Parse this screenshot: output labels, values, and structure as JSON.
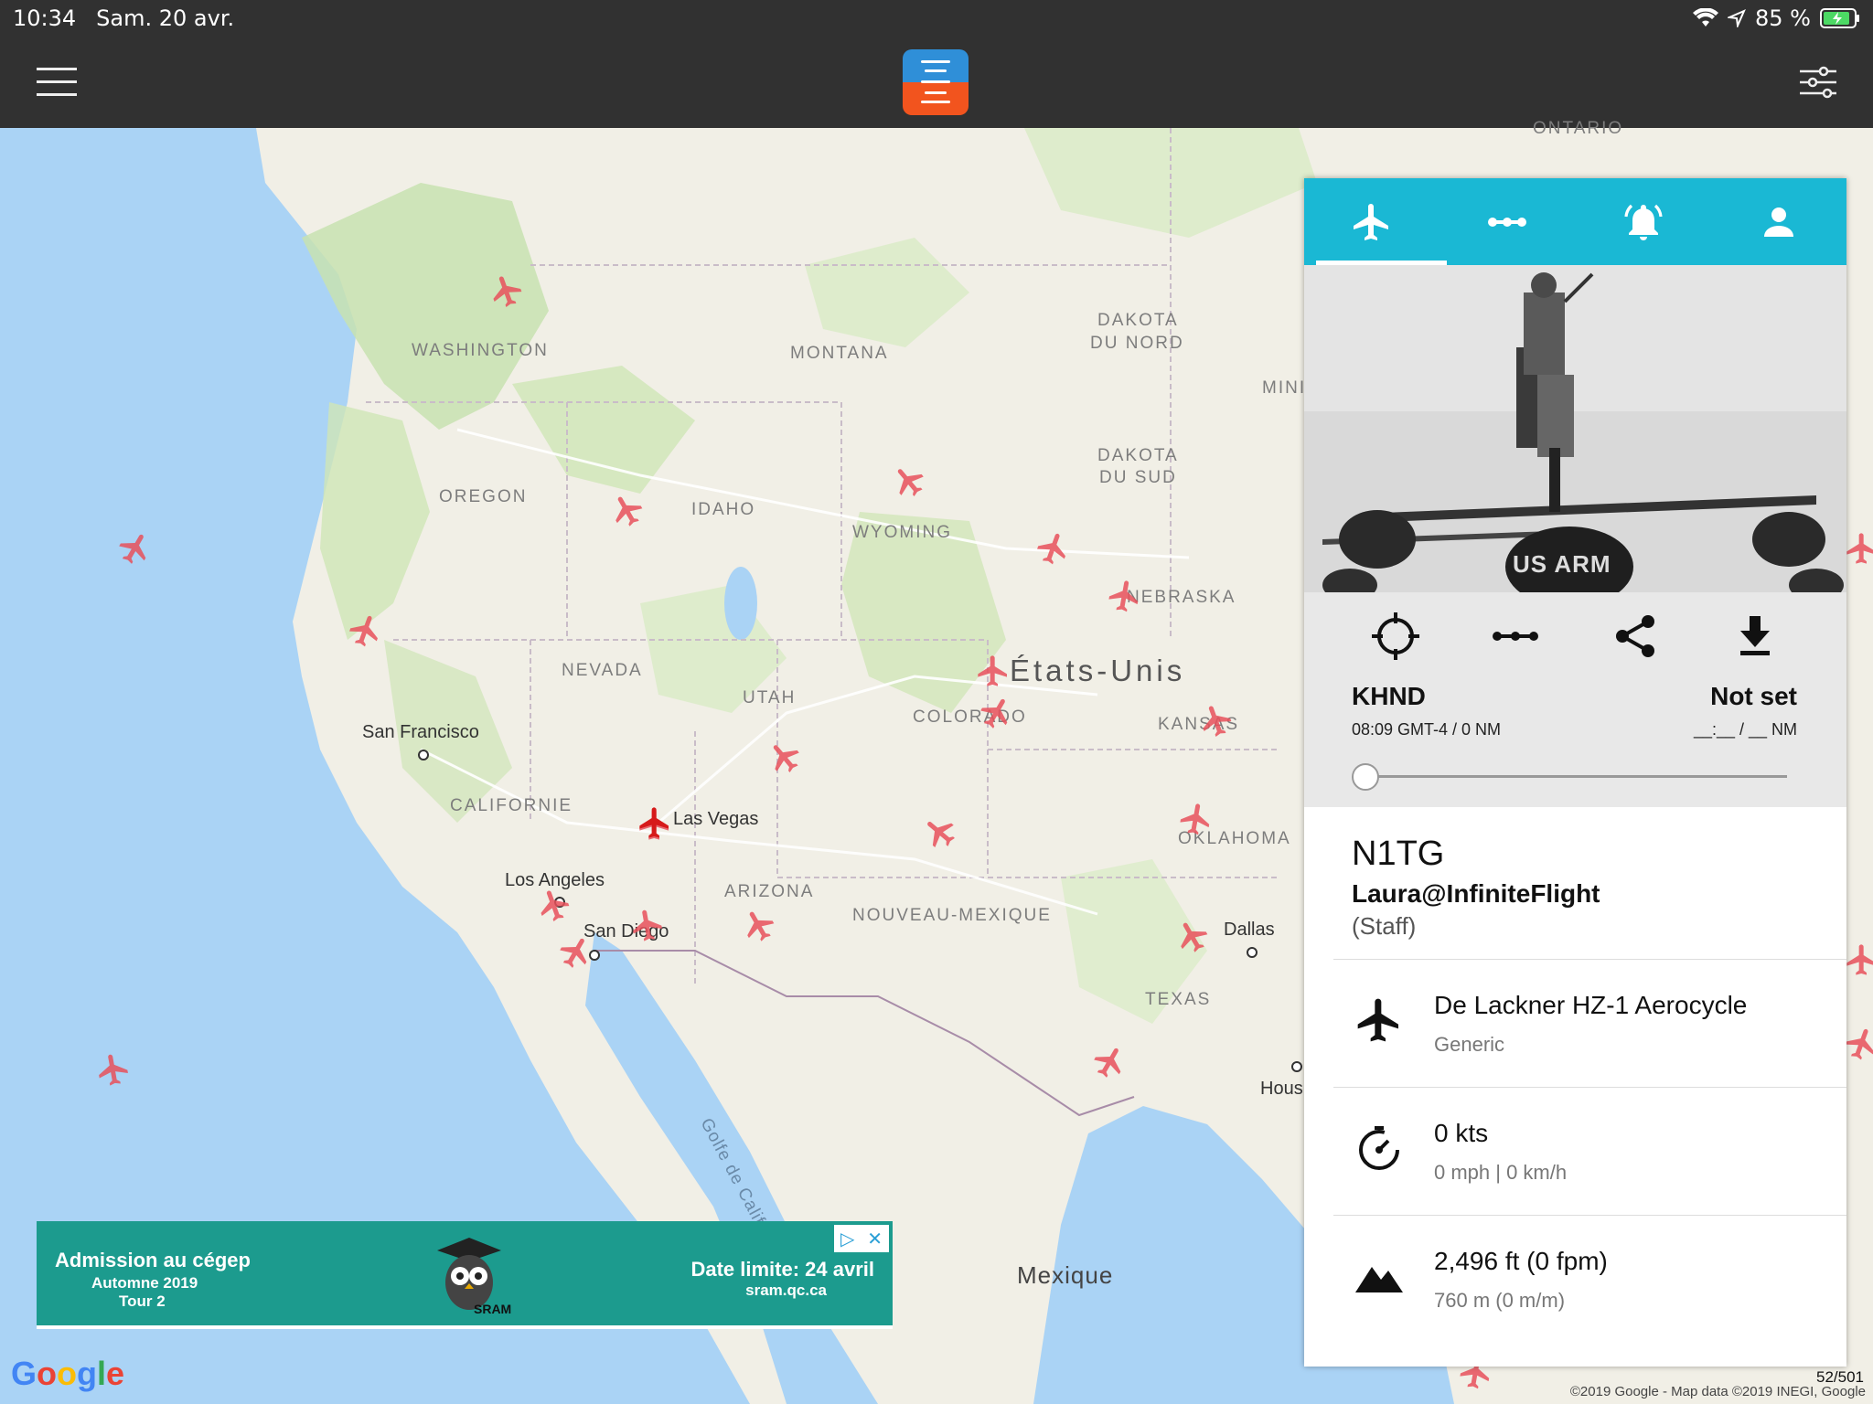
{
  "status_bar": {
    "time": "10:34",
    "date": "Sam. 20 avr.",
    "battery": "85 %"
  },
  "map": {
    "region_labels": [
      "WASHINGTON",
      "MONTANA",
      "DAKOTA",
      "DU NORD",
      "DAKOTA",
      "DU SUD",
      "OREGON",
      "IDAHO",
      "WYOMING",
      "NEBRASKA",
      "NEVADA",
      "UTAH",
      "COLORADO",
      "KANSAS",
      "CALIFORNIE",
      "ARIZONA",
      "NOUVEAU-MEXIQUE",
      "OKLAHOMA",
      "TEXAS",
      "ONTARIO",
      "MINI"
    ],
    "country_label": "États-Unis",
    "mexico_label": "Mexique",
    "gulf_label": "Golfe de Californie",
    "cities": [
      "San Francisco",
      "Las Vegas",
      "Los Angeles",
      "San Diego",
      "Dallas",
      "Hous"
    ]
  },
  "panel": {
    "tabs": [
      "airplane-icon",
      "route-icon",
      "bell-icon",
      "person-icon"
    ],
    "route": {
      "origin_code": "KHND",
      "origin_detail": "08:09 GMT-4 / 0 NM",
      "dest_code": "Not set",
      "dest_detail": "__:__ / __ NM",
      "progress": 0
    },
    "flight": {
      "callsign": "N1TG",
      "user": "Laura@InfiniteFlight",
      "role": "(Staff)"
    },
    "aircraft": {
      "name": "De Lackner HZ-1 Aerocycle",
      "livery": "Generic"
    },
    "speed": {
      "main": "0 kts",
      "sub": "0 mph | 0 km/h"
    },
    "altitude": {
      "main": "2,496 ft (0 fpm)",
      "sub": "760 m (0 m/m)"
    },
    "photo_text": "US ARM"
  },
  "ad": {
    "title": "Admission au cégep",
    "line2": "Automne 2019",
    "line3": "Tour 2",
    "brand": "SRAM",
    "deadline": "Date limite: 24 avril",
    "site": "sram.qc.ca"
  },
  "footer": {
    "google": "Google",
    "copyright": "©2019 Google - Map data ©2019 INEGI, Google",
    "counter": "52/501"
  },
  "colors": {
    "accent": "#1ab8d4",
    "topbar": "#313131",
    "plane": "#e8505b",
    "ad": "#1c9b8e"
  }
}
